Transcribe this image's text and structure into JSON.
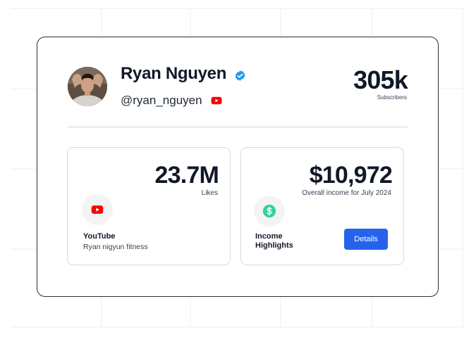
{
  "profile": {
    "name": "Ryan Nguyen",
    "handle": "@ryan_nguyen",
    "verified": true,
    "avatar_icon": "avatar-photo",
    "platform_icon": "youtube-icon"
  },
  "subscribers": {
    "value": "305k",
    "label": "Subscribers"
  },
  "likes_card": {
    "value": "23.7M",
    "label": "Likes",
    "platform": "YouTube",
    "channel": "Ryan nigyun fitness",
    "icon": "youtube-icon"
  },
  "income_card": {
    "value": "$10,972",
    "label": "Overall income for July 2024",
    "title": "Income Highlights",
    "icon": "dollar-icon",
    "button_label": "Details"
  },
  "colors": {
    "accent": "#2563eb",
    "youtube_red": "#ff0000",
    "verified_blue": "#1d9bf0",
    "income_green": "#34d399",
    "text_dark": "#111827"
  }
}
